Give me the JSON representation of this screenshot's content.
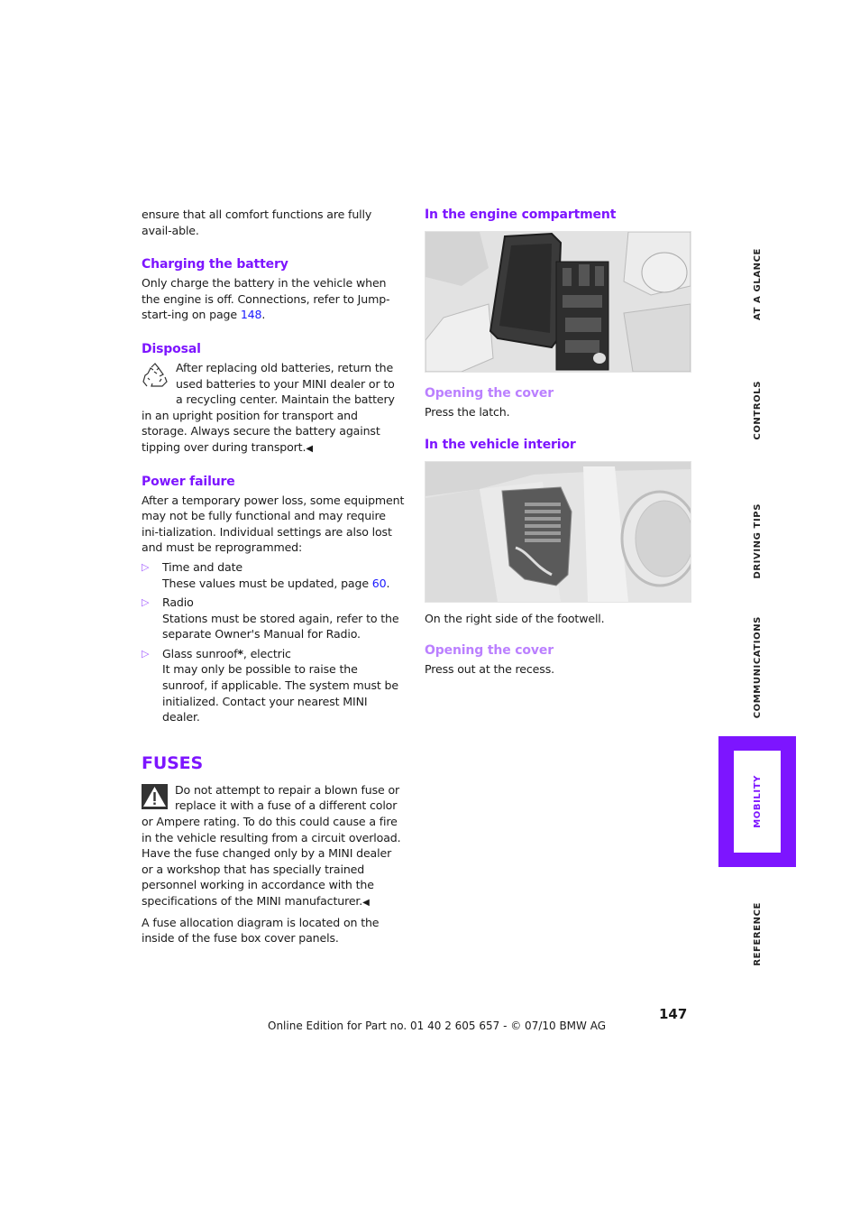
{
  "left_column": {
    "intro_text": "ensure that all comfort functions are fully avail-able.",
    "charging": {
      "heading": "Charging the battery",
      "text_before": "Only charge the battery in the vehicle when the engine is off. Connections, refer to Jump-start-ing on page ",
      "page_link": "148",
      "text_after": "."
    },
    "disposal": {
      "heading": "Disposal",
      "icon": "recycle-icon",
      "text": "After replacing old batteries, return the used batteries to your MINI dealer or to a recycling center. Maintain the battery in an upright position for transport and storage. Always secure the battery against tipping over during transport.",
      "end_mark": "◀"
    },
    "power_failure": {
      "heading": "Power failure",
      "text": "After a temporary power loss, some equipment may not be fully functional and may require ini-tialization. Individual settings are also lost and must be reprogrammed:",
      "bullet_symbol": "▷",
      "items": [
        {
          "title": "Time and date",
          "detail_before": "These values must be updated, page ",
          "page_link": "60",
          "detail_after": "."
        },
        {
          "title": "Radio",
          "detail": "Stations must be stored again, refer to the separate Owner's Manual for Radio."
        },
        {
          "title": "Glass sunroof",
          "title_marker": "*",
          "title_suffix": ", electric",
          "detail": "It may only be possible to raise the sunroof, if applicable. The system must be initialized. Contact your nearest MINI dealer."
        }
      ]
    },
    "fuses": {
      "heading": "FUSES",
      "warning_icon": "warning-icon",
      "warning_text": "Do not attempt to repair a blown fuse or replace it with a fuse of a different color or Ampere rating. To do this could cause a fire in the vehicle resulting from a circuit overload. Have the fuse changed only by a MINI dealer or a workshop that has specially trained personnel working in accordance with the specifications of the MINI manufacturer.",
      "end_mark": "◀",
      "diagram_note": "A fuse allocation diagram is located on the inside of the fuse box cover panels."
    }
  },
  "right_column": {
    "engine": {
      "heading": "In the engine compartment",
      "image_alt": "Fuse box in the engine compartment with cover opened",
      "sub_heading": "Opening the cover",
      "sub_text": "Press the latch."
    },
    "interior": {
      "heading": "In the vehicle interior",
      "image_alt": "Fuse box on the right side of the footwell",
      "caption": "On the right side of the footwell.",
      "sub_heading": "Opening the cover",
      "sub_text": "Press out at the recess."
    }
  },
  "side_nav": {
    "tabs": [
      {
        "label": "AT A GLANCE",
        "active": false
      },
      {
        "label": "CONTROLS",
        "active": false
      },
      {
        "label": "DRIVING TIPS",
        "active": false
      },
      {
        "label": "COMMUNICATIONS",
        "active": false
      },
      {
        "label": "MOBILITY",
        "active": true
      },
      {
        "label": "REFERENCE",
        "active": false
      }
    ]
  },
  "footer": {
    "page_number": "147",
    "edition": "Online Edition for Part no. 01 40 2 605 657 - © 07/10  BMW AG"
  },
  "colors": {
    "accent": "#7d15ff",
    "sub_heading": "#bb80ff",
    "link": "#1a1aff",
    "bullet": "#a15bff"
  }
}
